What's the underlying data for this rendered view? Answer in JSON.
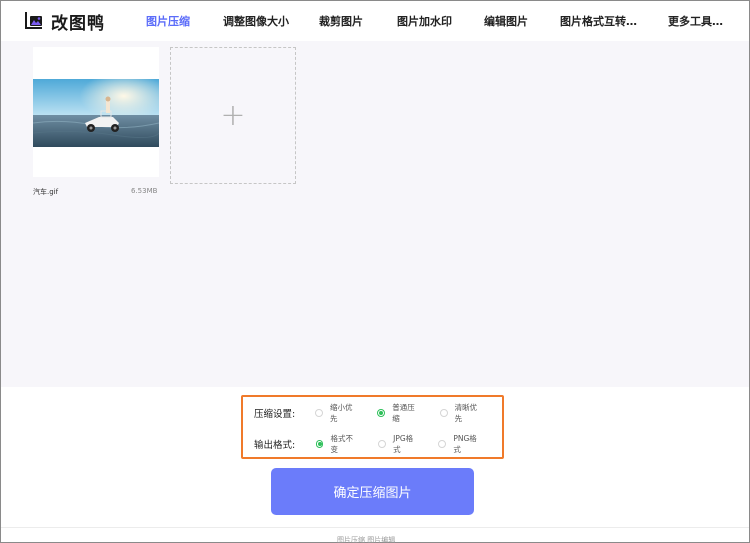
{
  "app": {
    "logo_text": "改图鸭"
  },
  "nav": {
    "items": [
      {
        "label": "图片压缩",
        "active": true
      },
      {
        "label": "调整图像大小"
      },
      {
        "label": "裁剪图片"
      },
      {
        "label": "图片加水印"
      },
      {
        "label": "编辑图片"
      },
      {
        "label": "图片格式互转…"
      },
      {
        "label": "更多工具…"
      }
    ]
  },
  "files": [
    {
      "name": "汽车.gif",
      "size": "6.53MB"
    }
  ],
  "upload": {
    "add_symbol": "+"
  },
  "settings": {
    "compress_label": "压缩设置:",
    "compress_options": [
      {
        "label": "缩小优先",
        "selected": false
      },
      {
        "label": "普通压缩",
        "selected": true
      },
      {
        "label": "清晰优先",
        "selected": false
      }
    ],
    "format_label": "输出格式:",
    "format_options": [
      {
        "label": "格式不变",
        "selected": true
      },
      {
        "label": "JPG格式",
        "selected": false
      },
      {
        "label": "PNG格式",
        "selected": false
      }
    ]
  },
  "confirm_button": "确定压缩图片",
  "footer": {
    "text": "图片压缩  图片编辑"
  },
  "colors": {
    "accent": "#5b6cf9",
    "button": "#6b7cfa",
    "highlight_border": "#f07a2a",
    "radio_selected": "#2ec05a",
    "upload_bg": "#f7f6fa"
  }
}
